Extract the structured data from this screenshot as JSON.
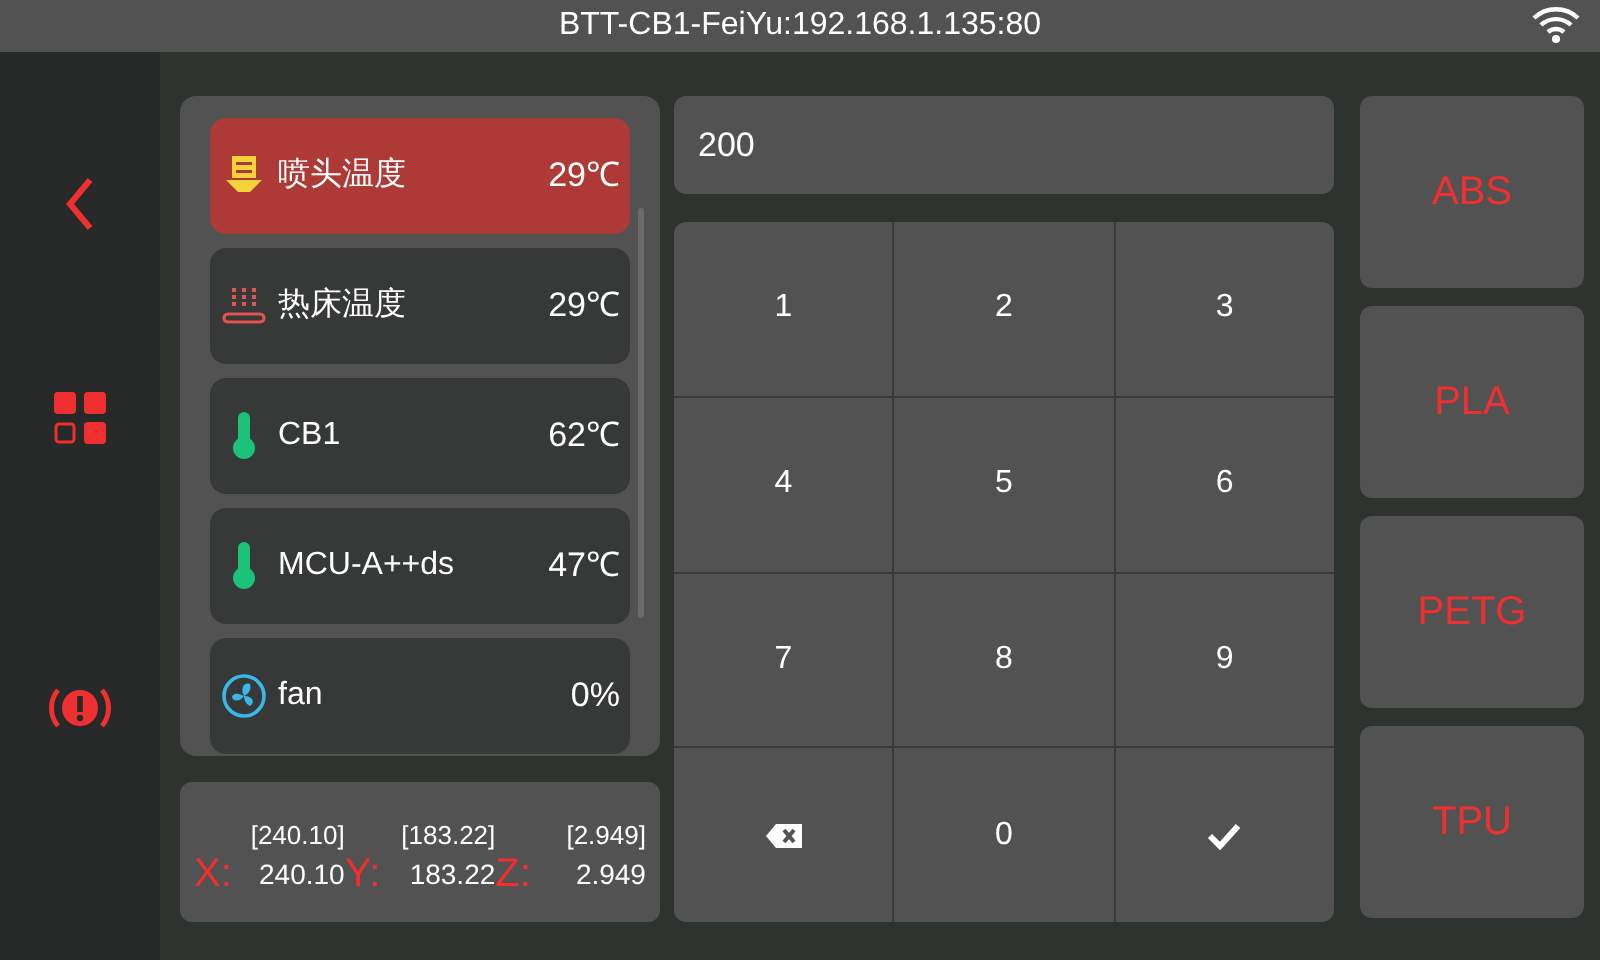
{
  "title_bar": {
    "title": "BTT-CB1-FeiYu:192.168.1.135:80"
  },
  "sensors": [
    {
      "kind": "extruder",
      "name": "喷头温度",
      "value": "29℃",
      "selected": true
    },
    {
      "kind": "bed",
      "name": "热床温度",
      "value": "29℃",
      "selected": false
    },
    {
      "kind": "sensor",
      "name": "CB1",
      "value": "62℃",
      "selected": false
    },
    {
      "kind": "sensor",
      "name": "MCU-A++ds",
      "value": "47℃",
      "selected": false
    },
    {
      "kind": "fan",
      "name": "fan",
      "value": "0%",
      "selected": false
    }
  ],
  "position": [
    {
      "axis": "X:",
      "target": "[240.10]",
      "value": "240.10"
    },
    {
      "axis": "Y:",
      "target": "[183.22]",
      "value": "183.22"
    },
    {
      "axis": "Z:",
      "target": "[2.949]",
      "value": "2.949"
    }
  ],
  "entry": {
    "value": "200"
  },
  "keypad": [
    {
      "kind": "digit",
      "label": "1"
    },
    {
      "kind": "digit",
      "label": "2"
    },
    {
      "kind": "digit",
      "label": "3"
    },
    {
      "kind": "digit",
      "label": "4"
    },
    {
      "kind": "digit",
      "label": "5"
    },
    {
      "kind": "digit",
      "label": "6"
    },
    {
      "kind": "digit",
      "label": "7"
    },
    {
      "kind": "digit",
      "label": "8"
    },
    {
      "kind": "digit",
      "label": "9"
    },
    {
      "kind": "backspace"
    },
    {
      "kind": "digit",
      "label": "0"
    },
    {
      "kind": "confirm"
    }
  ],
  "presets": [
    "ABS",
    "PLA",
    "PETG",
    "TPU"
  ]
}
